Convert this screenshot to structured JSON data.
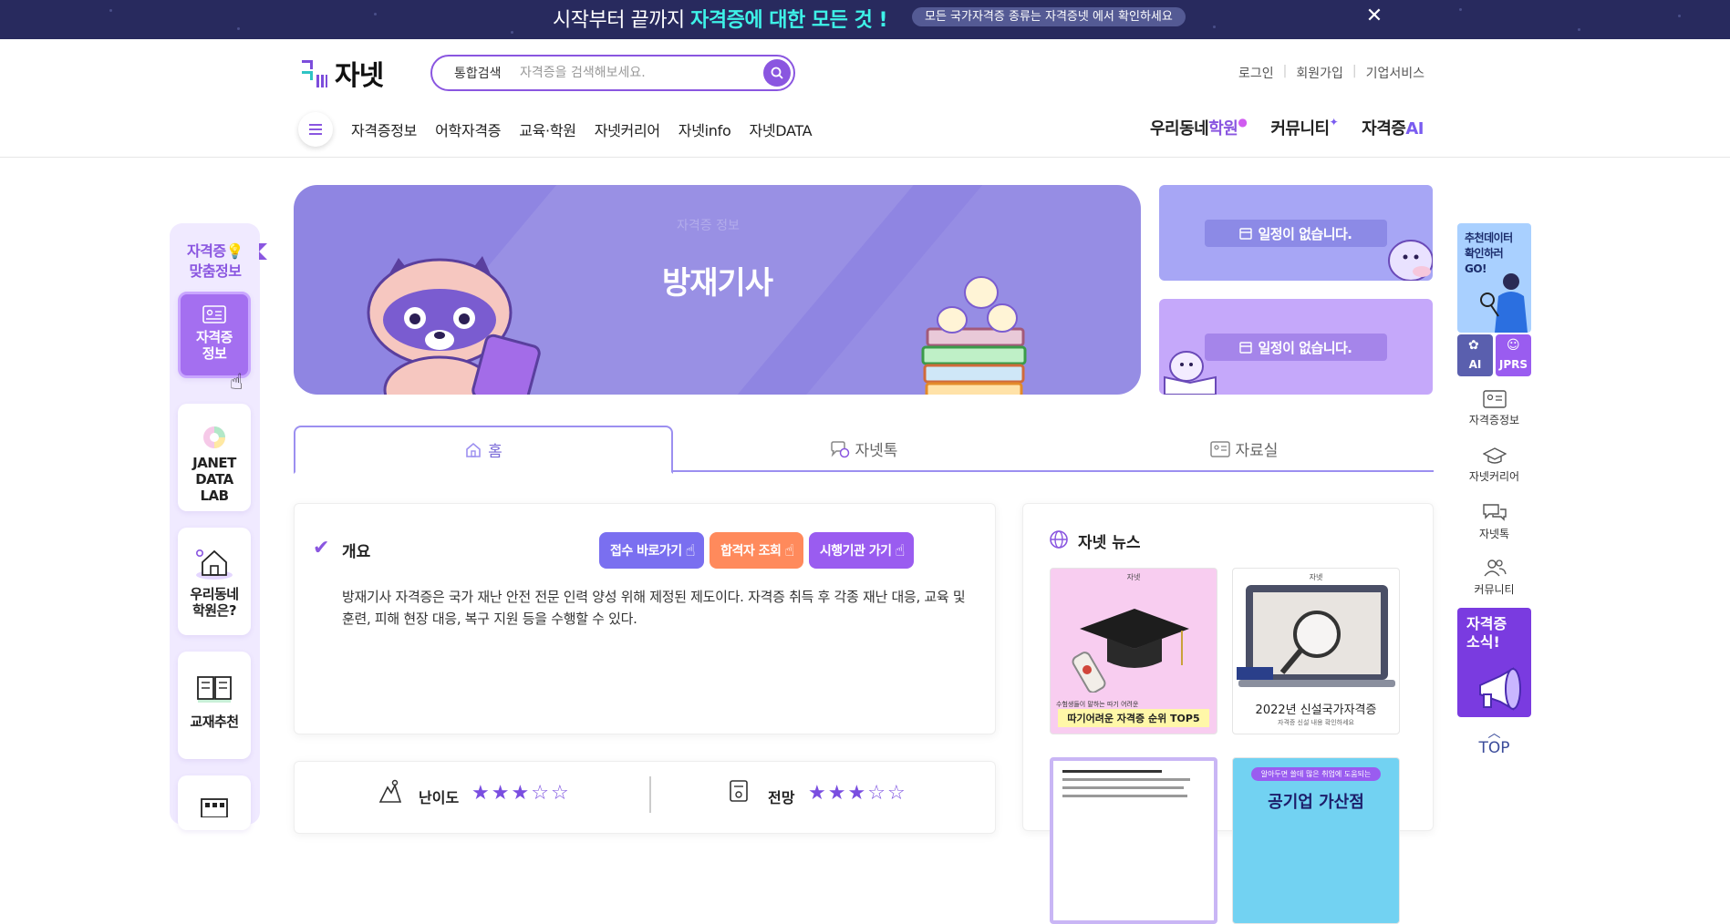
{
  "topbar": {
    "main_prefix": "시작부터 끝까지 ",
    "main_highlight": "자격증에 대한 모든 것 !",
    "pill": "모든 국가자격증 종류는 자격증넷 에서 확인하세요",
    "close": "✕"
  },
  "header": {
    "logo_text": "자넷",
    "search": {
      "label": "통합검색",
      "placeholder": "자격증을 검색해보세요."
    },
    "links": [
      "로그인",
      "회원가입",
      "기업서비스"
    ],
    "menu": [
      "자격증정보",
      "어학자격증",
      "교육·학원",
      "자넷커리어",
      "자넷info",
      "자넷DATA"
    ],
    "right_menu": {
      "academy_a": "우리동네",
      "academy_b": "학원",
      "community": "커뮤니티",
      "ai_a": "자격증",
      "ai_b": "AI"
    }
  },
  "leftbar": {
    "title_a": "자격증💡",
    "title_b": "맞춤정보",
    "items": [
      {
        "label_a": "자격증",
        "label_b": "정보"
      },
      {
        "label_a": "JANET",
        "label_b": "DATA",
        "label_c": "LAB"
      },
      {
        "label_a": "우리동네",
        "label_b": "학원은?"
      },
      {
        "label_a": "교재추천"
      }
    ]
  },
  "banner": {
    "title": "방재기사",
    "faint": "자격증 정보"
  },
  "schedule": {
    "empty_label": "일정이 없습니다."
  },
  "tabs": [
    "홈",
    "자넷톡",
    "자료실"
  ],
  "overview": {
    "heading": "개요",
    "buttons": [
      "접수 바로가기",
      "합격자 조회",
      "시행기관 가기"
    ],
    "description": "방재기사 자격증은 국가 재난 안전 전문 인력 양성 위해 제정된 제도이다. 자격증 취득 후 각종 재난 대응, 교육 및 훈련, 피해 현장 대응, 복구 지원 등을 수행할 수 있다."
  },
  "news": {
    "heading": "자넷 뉴스",
    "items": [
      {
        "brand": "자넷",
        "small": "수험생들이 말하는 따기 어려운",
        "caption": "따기어려운 자격증 순위 TOP5"
      },
      {
        "brand": "자넷",
        "caption": "2022년 신설국가자격증",
        "small": "자격증 신설 내용 확인하세요"
      },
      {
        "caption": ""
      },
      {
        "small": "알아두면 쓸데 많은 취업에 도움되는",
        "caption": "공기업 가산점"
      }
    ]
  },
  "stats": {
    "difficulty": {
      "label": "난이도",
      "rating": 3,
      "max": 5
    },
    "outlook": {
      "label": "전망",
      "rating": 3,
      "max": 5
    }
  },
  "rightbar": {
    "promo": [
      "추천데이터",
      "확인하러",
      "GO!"
    ],
    "ai_label": "AI",
    "jprs_label": "JPRS",
    "items": [
      "자격증정보",
      "자넷커리어",
      "자넷톡",
      "커뮤니티"
    ],
    "news_promo": [
      "자격증",
      "소식!"
    ],
    "top_label": "TOP"
  },
  "colors": {
    "topbar_bg": "#282a5e",
    "accent": "#8a56e0",
    "highlight": "#3ef2e8",
    "banner_bg": "#8f85e2",
    "btn_apply": "#7a6ff0",
    "btn_result": "#ff8a5c",
    "btn_org": "#9a5cf0",
    "star": "#7a4ee0"
  }
}
